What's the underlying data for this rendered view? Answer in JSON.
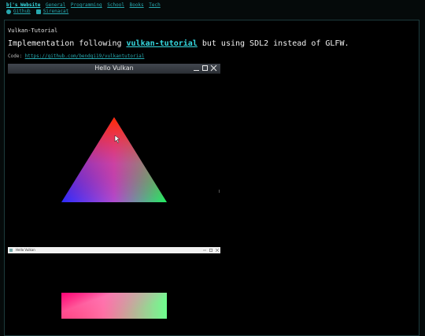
{
  "header": {
    "site_title": "bj's Website",
    "nav": [
      "General",
      "Programming",
      "School",
      "Books",
      "Tech"
    ],
    "social": [
      "Github",
      "Sirenacat"
    ]
  },
  "content": {
    "section_title": "Vulkan-Tutorial",
    "lead_before": "Implementation following ",
    "lead_link": "vulkan-tutorial",
    "lead_after": " but using SDL2 instead of GLFW.",
    "code_label": "Code: ",
    "code_url": "https://github.com/bendgi19/vulkantutorial"
  },
  "window1": {
    "title": "Hello Vulkan"
  },
  "window2": {
    "title": "Hello Vulkan"
  },
  "colors": {
    "accent": "#36d9e0",
    "link": "#27a9b0",
    "background": "#050a0a"
  }
}
